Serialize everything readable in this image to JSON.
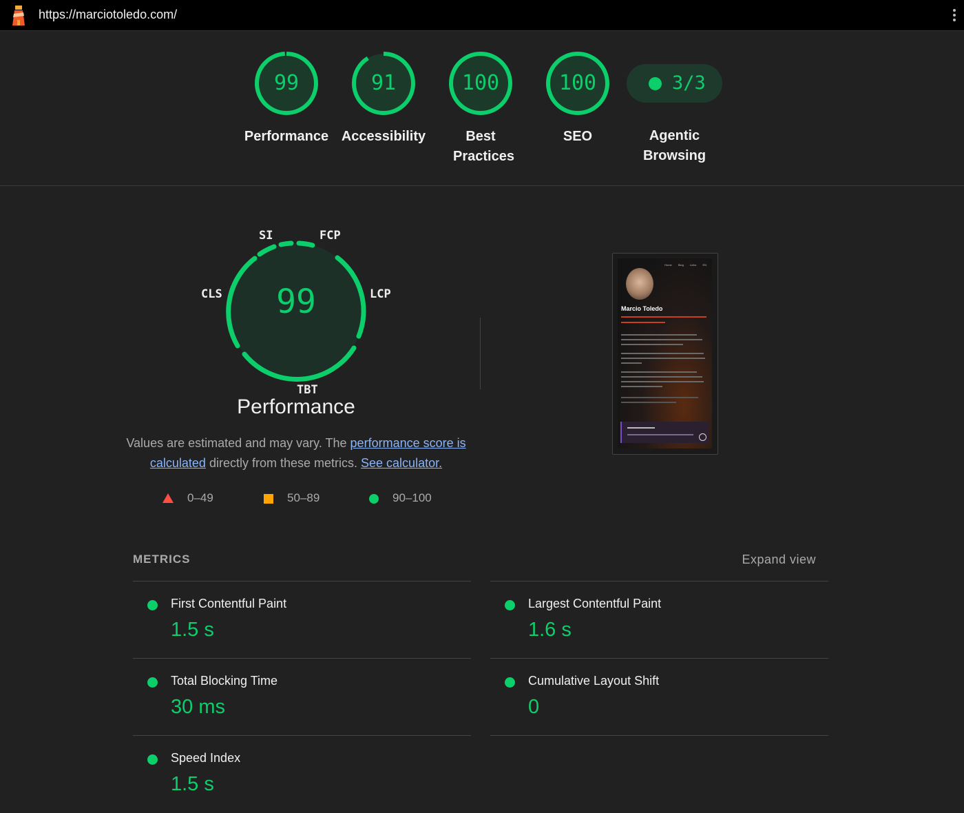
{
  "topbar": {
    "url": "https://marciotoledo.com/"
  },
  "categories": [
    {
      "label": "Performance",
      "score": "99"
    },
    {
      "label": "Accessibility",
      "score": "91"
    },
    {
      "label": "Best Practices",
      "score": "100"
    },
    {
      "label": "SEO",
      "score": "100"
    }
  ],
  "agentic": {
    "label": "Agentic Browsing",
    "value": "3/3"
  },
  "performance": {
    "score": "99",
    "title": "Performance",
    "tags": {
      "si": "SI",
      "fcp": "FCP",
      "cls": "CLS",
      "lcp": "LCP",
      "tbt": "TBT"
    },
    "desc_before": "Values are estimated and may vary. The ",
    "desc_link1": "performance score is calculated",
    "desc_middle": " directly from these metrics. ",
    "desc_link2": "See calculator."
  },
  "legend": {
    "low": "0–49",
    "mid": "50–89",
    "high": "90–100"
  },
  "thumbnail": {
    "nav": "Home Blog Links EN",
    "name": "Marcio Toledo"
  },
  "metrics": {
    "heading": "METRICS",
    "expand": "Expand view",
    "items": [
      {
        "name": "First Contentful Paint",
        "value": "1.5 s"
      },
      {
        "name": "Largest Contentful Paint",
        "value": "1.6 s"
      },
      {
        "name": "Total Blocking Time",
        "value": "30 ms"
      },
      {
        "name": "Cumulative Layout Shift",
        "value": "0"
      },
      {
        "name": "Speed Index",
        "value": "1.5 s"
      }
    ]
  },
  "colors": {
    "pass": "#0cce6b",
    "average": "#ffa400",
    "fail": "#ff4e42",
    "background": "#212121"
  }
}
